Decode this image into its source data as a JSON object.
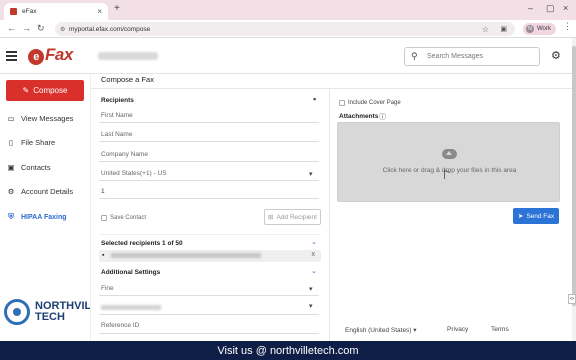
{
  "browser": {
    "tab_title": "eFax",
    "url": "myportal.efax.com/compose",
    "profile_label": "Work",
    "profile_initial": "N"
  },
  "header": {
    "logo_text": "eFax",
    "search_placeholder": "Search Messages"
  },
  "sidebar": {
    "compose_label": "Compose",
    "items": [
      {
        "label": "View Messages",
        "icon": "inbox-icon"
      },
      {
        "label": "File Share",
        "icon": "file-icon"
      },
      {
        "label": "Contacts",
        "icon": "contacts-icon"
      },
      {
        "label": "Account Details",
        "icon": "gear-icon"
      },
      {
        "label": "HIPAA Faxing",
        "icon": "shield-icon"
      }
    ],
    "brand": {
      "line1": "NORTHVILLE",
      "line2": "TECH"
    }
  },
  "compose": {
    "title": "Compose a Fax",
    "recipients_heading": "Recipients",
    "first_name_placeholder": "First Name",
    "last_name_placeholder": "Last Name",
    "company_placeholder": "Company Name",
    "country_value": "United States(+1) - US",
    "fax_number_value": "1",
    "save_contact_label": "Save Contact",
    "add_recipient_label": "Add Recipient",
    "selected_recipients_label": "Selected recipients 1 of 50",
    "additional_settings_label": "Additional Settings",
    "resolution_value": "Fine",
    "reference_id_placeholder": "Reference ID",
    "include_cover_label": "Include Cover Page",
    "attachments_label": "Attachments",
    "dropzone_text": "Click here or drag & drop your files in this area",
    "send_fax_label": "Send Fax"
  },
  "footer": {
    "language": "English (United States)",
    "privacy": "Privacy",
    "terms": "Terms"
  },
  "banner": {
    "text": "Visit us @ northvilletech.com"
  },
  "colors": {
    "compose_red": "#d9302c",
    "send_blue": "#2b73d6",
    "banner_navy": "#0f1e46",
    "hipaa_blue": "#2a6ad0"
  }
}
